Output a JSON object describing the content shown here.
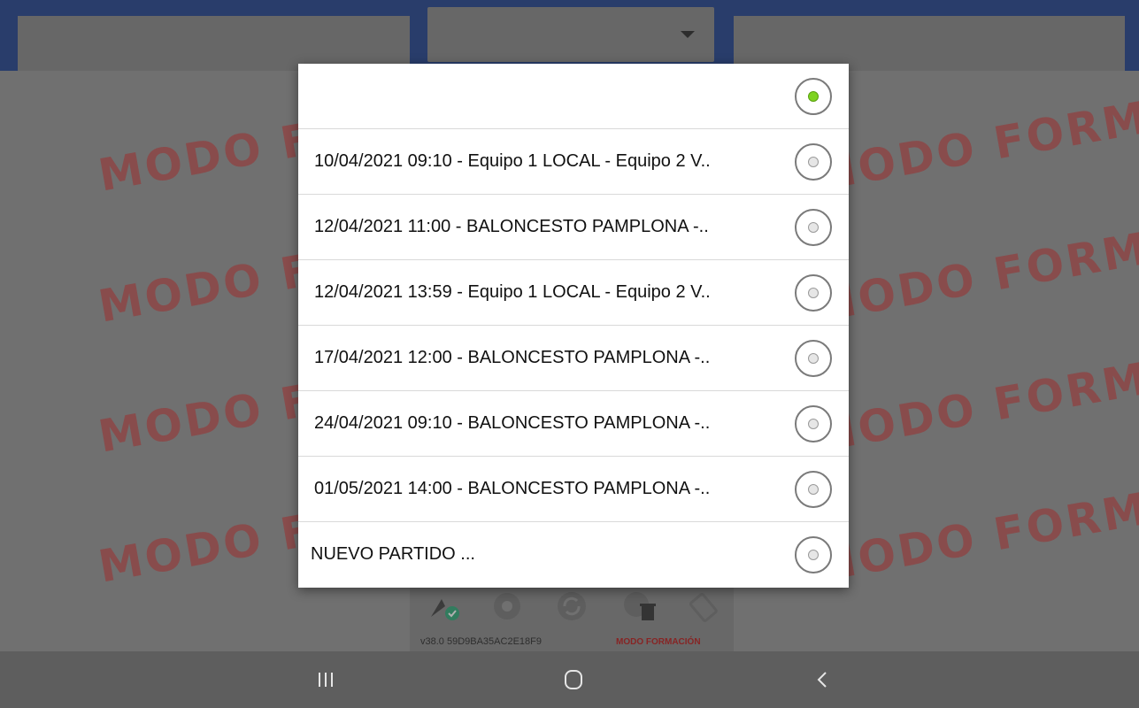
{
  "watermark_text": "MODO FORMACIÓN",
  "watermark_left_text": "MODO FO",
  "watermark_right_text": "MODO FORMA",
  "match_options": [
    {
      "label": "",
      "checked": true
    },
    {
      "label": "10/04/2021 09:10 - Equipo 1 LOCAL - Equipo 2 V..",
      "checked": false
    },
    {
      "label": "12/04/2021 11:00 - BALONCESTO PAMPLONA -..",
      "checked": false
    },
    {
      "label": "12/04/2021 13:59 - Equipo 1 LOCAL - Equipo 2 V..",
      "checked": false
    },
    {
      "label": "17/04/2021 12:00 - BALONCESTO PAMPLONA -..",
      "checked": false
    },
    {
      "label": "24/04/2021 09:10 - BALONCESTO PAMPLONA -..",
      "checked": false
    },
    {
      "label": "01/05/2021 14:00 - BALONCESTO PAMPLONA -..",
      "checked": false
    },
    {
      "label": "NUEVO PARTIDO ...",
      "checked": false
    }
  ],
  "footer": {
    "version": "v38.0  59D9BA35AC2E18F9",
    "mode_label": "MODO FORMACIÓN"
  },
  "icons": [
    "flag-check-icon",
    "gear-icon",
    "sync-icon",
    "delete-icon",
    "rotate-icon"
  ],
  "navbar": {
    "buttons": [
      "recent-apps-icon",
      "home-icon",
      "back-icon"
    ]
  },
  "colors": {
    "topbar": "#0a2e82",
    "watermark": "#c23a3a",
    "selected_radio": "#7ed321",
    "mode_label": "#b40000"
  }
}
